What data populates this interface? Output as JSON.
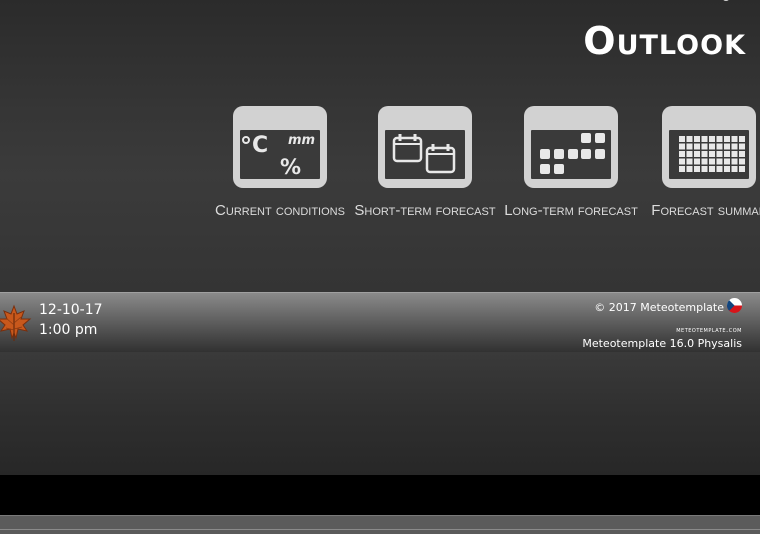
{
  "header": {
    "title": "Outlook"
  },
  "tiles": [
    {
      "label": "Current conditions",
      "icon": "current-conditions-icon"
    },
    {
      "label": "Short-term forecast",
      "icon": "short-term-calendar-icon"
    },
    {
      "label": "Long-term forecast",
      "icon": "long-term-calendar-icon"
    },
    {
      "label": "Forecast summar",
      "icon": "forecast-summary-grid-icon"
    }
  ],
  "footer": {
    "date": "12-10-17",
    "time": "1:00 pm",
    "copyright": "© 2017 Meteotemplate",
    "site": "meteotemplate.com",
    "version": "Meteotemplate 16.0 Physalis",
    "season_icon": "autumn-leaf-icon",
    "flag_icon": "czech-flag-icon"
  },
  "colors": {
    "tile_background": "#d2d2d2",
    "tile_screen": "#3a3a3a",
    "title_text": "#ffffff",
    "label_text": "#dcdcdc",
    "footer_gradient_top": "#8a8a8a",
    "footer_gradient_bottom": "#303030"
  }
}
